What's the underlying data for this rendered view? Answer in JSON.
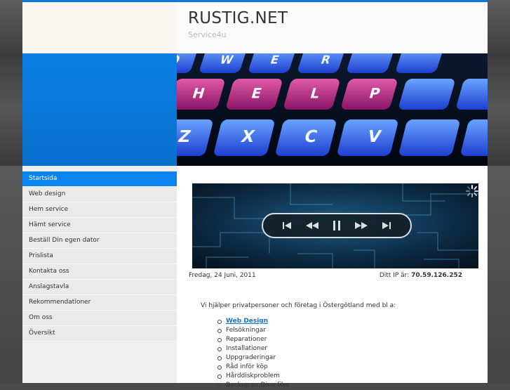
{
  "site": {
    "title": "RUSTIG.NET",
    "subtitle": "Service4u"
  },
  "banner": {
    "keys": [
      "Q",
      "W",
      "E",
      "R",
      "H",
      "E",
      "L",
      "P",
      "Z",
      "X",
      "C",
      "V"
    ]
  },
  "nav": {
    "items": [
      {
        "label": "Startsida",
        "active": true
      },
      {
        "label": "Web design"
      },
      {
        "label": "Hem service"
      },
      {
        "label": "Hämt service"
      },
      {
        "label": "Beställ Din egen dator"
      },
      {
        "label": "Prislista"
      },
      {
        "label": "Kontakta oss"
      },
      {
        "label": "Anslagstavla"
      },
      {
        "label": "Rekommendationer"
      },
      {
        "label": "Om oss"
      },
      {
        "label": "Översikt"
      }
    ]
  },
  "player": {
    "controls": [
      "skip-back-icon",
      "rewind-icon",
      "pause-icon",
      "fast-forward-icon",
      "skip-forward-icon"
    ]
  },
  "info": {
    "date": "Fredag, 24 Juni, 2011",
    "ip_label": "Ditt IP är:",
    "ip_value": "70.59.126.252"
  },
  "main": {
    "intro": "Vi hjälper privatpersoner och företag i Östergötland med bl a:",
    "services": [
      "Web Design",
      "Felsökningar",
      "Reparationer",
      "Installationer",
      "Uppgraderingar",
      "Råd inför köp",
      "Hårddiskproblem",
      "Backup av Dina filer"
    ]
  },
  "colors": {
    "accent": "#0a84ee",
    "link": "#1572c9"
  }
}
